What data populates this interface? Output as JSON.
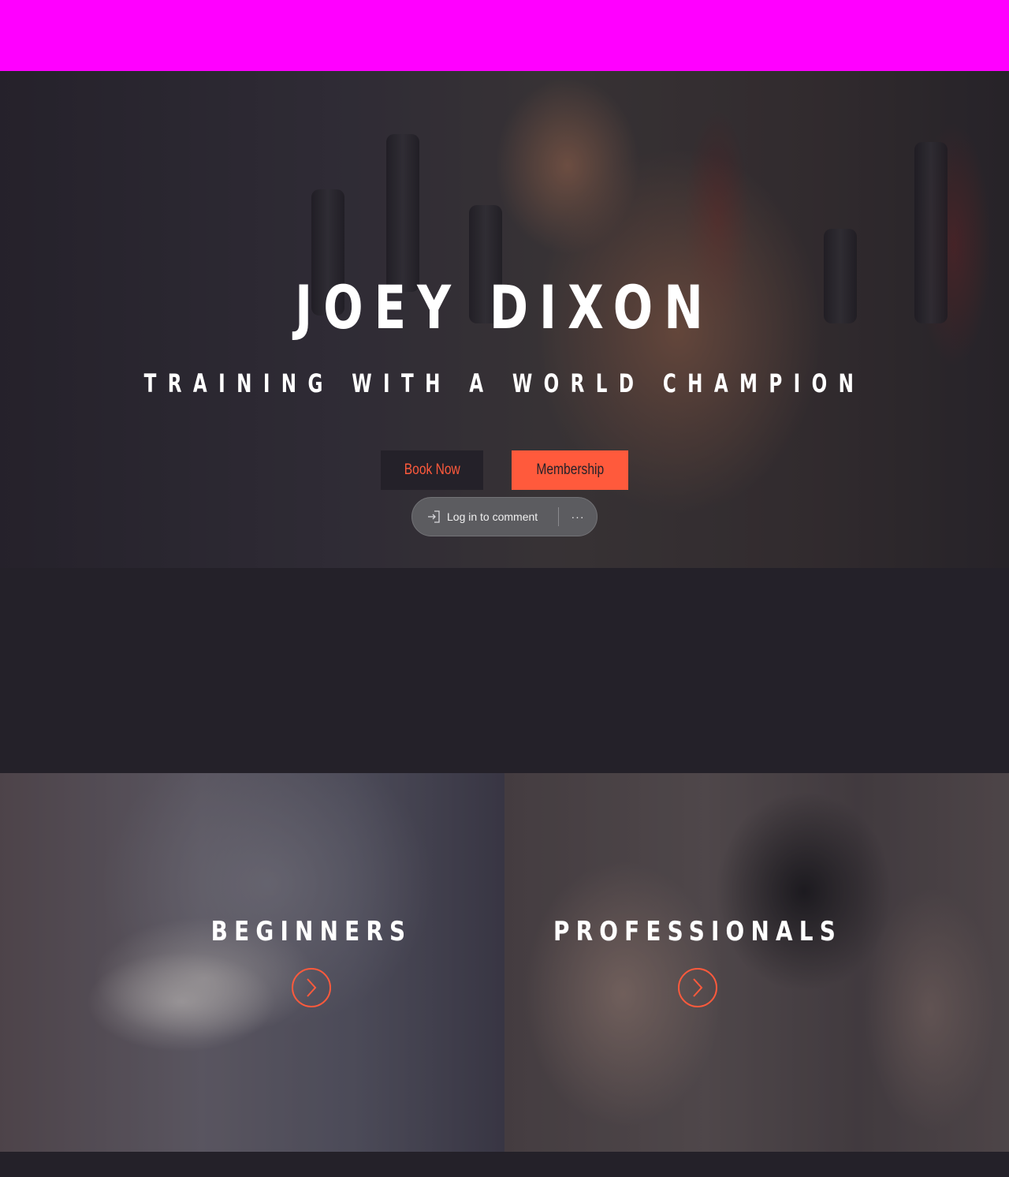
{
  "hero": {
    "title": "JOEY DIXON",
    "subtitle": "TRAINING WITH A WORLD CHAMPION",
    "book_button": "Book Now",
    "membership_button": "Membership"
  },
  "comment_bar": {
    "login_label": "Log in to comment",
    "more_label": "···"
  },
  "cards": [
    {
      "title": "BEGINNERS",
      "icon": "chevron-right-circle-icon"
    },
    {
      "title": "PROFESSIONALS",
      "icon": "chevron-right-circle-icon"
    }
  ],
  "colors": {
    "top_bar": "#ff00ff",
    "background": "#242129",
    "accent": "#ff5a3c"
  }
}
